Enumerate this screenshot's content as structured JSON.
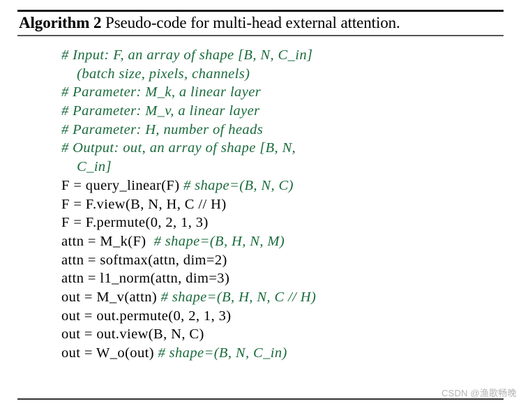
{
  "caption": {
    "label": "Algorithm 2",
    "title": " Pseudo-code for multi-head external attention."
  },
  "code": {
    "lines": [
      {
        "indent": 0,
        "comment": "# Input: F, an array of shape [B, N, C_in]"
      },
      {
        "indent": 4,
        "comment": "(batch size, pixels, channels)"
      },
      {
        "indent": 0,
        "comment": "# Parameter: M_k, a linear layer"
      },
      {
        "indent": 0,
        "comment": "# Parameter: M_v, a linear layer"
      },
      {
        "indent": 0,
        "comment": "# Parameter: H, number of heads"
      },
      {
        "indent": 0,
        "comment": "# Output: out, an array of shape [B, N,"
      },
      {
        "indent": 4,
        "comment": "C_in]"
      },
      {
        "indent": 0,
        "code": "F = query_linear(F) ",
        "comment": "# shape=(B, N, C)"
      },
      {
        "indent": 0,
        "code": "F = F.view(B, N, H, C // H)"
      },
      {
        "indent": 0,
        "code": "F = F.permute(0, 2, 1, 3)"
      },
      {
        "indent": 0,
        "code": "attn = M_k(F)  ",
        "comment": "# shape=(B, H, N, M)"
      },
      {
        "indent": 0,
        "code": "attn = softmax(attn, dim=2)"
      },
      {
        "indent": 0,
        "code": "attn = l1_norm(attn, dim=3)"
      },
      {
        "indent": 0,
        "code": "out = M_v(attn) ",
        "comment": "# shape=(B, H, N, C // H)"
      },
      {
        "indent": 0,
        "code": "out = out.permute(0, 2, 1, 3)"
      },
      {
        "indent": 0,
        "code": "out = out.view(B, N, C)"
      },
      {
        "indent": 0,
        "code": "out = W_o(out) ",
        "comment": "# shape=(B, N, C_in)"
      }
    ]
  },
  "watermark": {
    "text": "CSDN @渔歌畅晚"
  },
  "colors": {
    "comment_green": "#1a6b3c",
    "code_black": "#000000",
    "rule": "#1a1a1a",
    "watermark": "#b4b4b4"
  }
}
